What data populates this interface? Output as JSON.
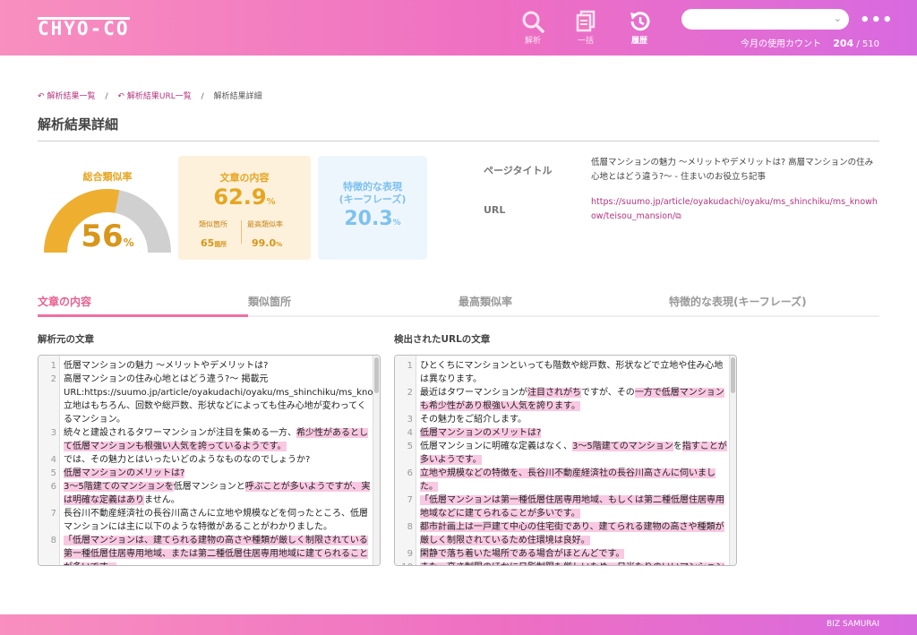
{
  "header": {
    "logo": "CHYO-CO",
    "nav": [
      {
        "label": "解析",
        "icon": "search-icon"
      },
      {
        "label": "一括",
        "icon": "documents-icon"
      },
      {
        "label": "履歴",
        "icon": "history-icon"
      }
    ],
    "select_value": "",
    "usage_label": "今月の使用カウント",
    "usage_used": "204",
    "usage_total": "/ 510"
  },
  "breadcrumb": [
    "解析結果一覧",
    "解析結果URL一覧",
    "解析結果詳細"
  ],
  "page_title": "解析結果詳細",
  "overall": {
    "label": "総合類似率",
    "value": "56",
    "unit": "%",
    "fraction": 0.56
  },
  "content_card": {
    "title": "文章の内容",
    "value": "62.9",
    "unit": "%",
    "sub1_label": "類似箇所",
    "sub1_value": "65",
    "sub1_unit": "箇所",
    "sub2_label": "最高類似率",
    "sub2_value": "99.0",
    "sub2_unit": "%"
  },
  "keyphrase_card": {
    "title1": "特徴的な表現",
    "title2": "(キーフレーズ)",
    "value": "20.3",
    "unit": "%"
  },
  "meta": {
    "page_title_label": "ページタイトル",
    "page_title_value": "低層マンションの魅力 〜メリットやデメリットは? 高層マンションの住み心地とはどう違う?〜 - 住まいのお役立ち記事",
    "url_label": "URL",
    "url_value": "https://suumo.jp/article/oyakudachi/oyaku/ms_shinchiku/ms_knowhow/teisou_mansion/"
  },
  "tabs": [
    "文章の内容",
    "類似箇所",
    "最高類似率",
    "特徴的な表現(キーフレーズ)"
  ],
  "source": {
    "title": "解析元の文章",
    "lines": [
      {
        "n": "1",
        "segs": [
          {
            "t": "低層マンションの魅力 〜メリットやデメリットは?",
            "h": false
          }
        ]
      },
      {
        "n": "2",
        "segs": [
          {
            "t": " 高層マンションの住み心地とはどう違う?〜  掲載元URL:https://suumo.jp/article/oyakudachi/oyaku/ms_shinchiku/ms_knowhow/teisou_mansion/  立地はもちろん、回数や総戸数、形状などによっても住み心地が変わってくるマンション。",
            "h": false
          }
        ]
      },
      {
        "n": "3",
        "segs": [
          {
            "t": "続々と建設されるタワーマンションが注目を集める一方、",
            "h": false
          },
          {
            "t": "希少性があるとして低層マンションも根強い人気を誇っているようです。",
            "h": true
          }
        ]
      },
      {
        "n": "4",
        "segs": [
          {
            "t": "では、その魅力とはいったいどのようなものなのでしょうか?",
            "h": false
          }
        ]
      },
      {
        "n": "5",
        "segs": [
          {
            "t": " 低層マンションのメリットは?",
            "h": true
          }
        ]
      },
      {
        "n": "6",
        "segs": [
          {
            "t": "3〜5階建てのマンションを",
            "h": true
          },
          {
            "t": "低層マンションと",
            "h": false
          },
          {
            "t": "呼ぶことが多いよう",
            "h": true
          },
          {
            "t": "ですが、実は明確な定義はあり",
            "h": true
          },
          {
            "t": "ません。",
            "h": false
          }
        ]
      },
      {
        "n": "7",
        "segs": [
          {
            "t": "長谷川不動産経済社の長谷川高さんに立地や規模などを伺ったところ、低層マンションには主に以下のような特徴があることがわかりました。",
            "h": false
          }
        ]
      },
      {
        "n": "8",
        "segs": [
          {
            "t": "「低層マンションは、建てられる建物の高さや種類が厳しく制限されている第一種低層住居専用地域、または第二種低層住居専用地域に建てられることが多いです。",
            "h": true
          }
        ]
      }
    ]
  },
  "detected": {
    "title": "検出されたURLの文章",
    "lines": [
      {
        "n": "1",
        "segs": [
          {
            "t": "ひとくちにマンションといっても階数や総戸数、形状などで立地や住み心地は異なります。",
            "h": false
          }
        ]
      },
      {
        "n": "2",
        "segs": [
          {
            "t": "最近はタワーマンションが",
            "h": false
          },
          {
            "t": "注目されがち",
            "h": true
          },
          {
            "t": "ですが、その",
            "h": false
          },
          {
            "t": "一方で低層マンションも希少性があり根強い人気を誇ります。",
            "h": true
          }
        ]
      },
      {
        "n": "3",
        "segs": [
          {
            "t": "その魅力をご紹介します。",
            "h": false
          }
        ]
      },
      {
        "n": "4",
        "segs": [
          {
            "t": "低層マンションのメリットは?",
            "h": true
          }
        ]
      },
      {
        "n": "5",
        "segs": [
          {
            "t": "低層マンションに明確な定義はなく、",
            "h": false
          },
          {
            "t": "3〜5階建てのマンション",
            "h": true
          },
          {
            "t": "を",
            "h": false
          },
          {
            "t": "指すことが多いようです。",
            "h": true
          }
        ]
      },
      {
        "n": "6",
        "segs": [
          {
            "t": "立地や規模などの特徴を、長谷川不動産経済社の長谷川高さんに伺いました。",
            "h": true
          }
        ]
      },
      {
        "n": "7",
        "segs": [
          {
            "t": "「低層マンションは第一種低層住居専用地域、もしくは第二種低層住居専用地域などに建てられることが多いです。",
            "h": true
          }
        ]
      },
      {
        "n": "8",
        "segs": [
          {
            "t": "都市計画上は一戸建て中心の住宅街であり、建てられる建物の高さや種類が厳しく制限されているため住環境は良好。",
            "h": true
          }
        ]
      },
      {
        "n": "9",
        "segs": [
          {
            "t": "閑静で落ち着いた場所である場合がほとんどです。",
            "h": true
          }
        ]
      },
      {
        "n": "10",
        "segs": [
          {
            "t": "また、高さ制限のほかに日影制限も厳しいため、日当たりのいいマンション",
            "h": true
          }
        ]
      }
    ]
  },
  "footer": "BIZ SAMURAI",
  "colors": {
    "accent": "#f070a0",
    "gauge": "#eeaf30",
    "gauge_bg": "#d0d0d0",
    "highlight": "#f9c8e2",
    "keyphrase": "#7fc1ef"
  }
}
